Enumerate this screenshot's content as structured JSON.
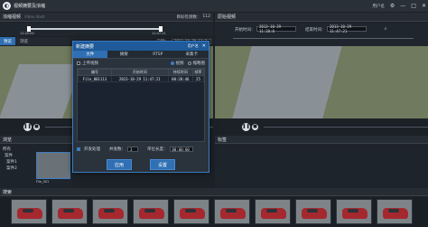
{
  "app": {
    "title": "视频摘要及浓缩",
    "user": "用户名"
  },
  "left_panel": {
    "title": "浓缩视频",
    "subtitle": "Video Abstr",
    "frame_label": "目标检测数：",
    "frame_value": "112",
    "time_start": "11:20:00",
    "time_end": "11:47:21"
  },
  "right_panel": {
    "title": "原始视频",
    "start_label": "开始时间：",
    "start_value": "2013-10-29 11:20:0",
    "end_label": "结束时间：",
    "end_value": "2013-10-29 11:47:21"
  },
  "left_tabs": [
    "预览",
    "浏览"
  ],
  "left_date_label": "日期：",
  "left_date_value": "2013-10-29 11:2",
  "dialog": {
    "title": "新建摘要",
    "user": "用户名",
    "tabs": [
      "文件",
      "摘要",
      "RTSP",
      "采集卡"
    ],
    "upload_label": "上传视频",
    "option_video": "视频",
    "option_thumb": "缩略图",
    "table_headers": [
      "编号",
      "开始时间",
      "持续时间",
      "帧率"
    ],
    "rows": [
      {
        "id": "File_001113",
        "start": "2013-10-29 11:47:21",
        "duration": "00:20:46",
        "fps": "25"
      }
    ],
    "batch_label": "开发处理",
    "concurrency_label": "并发数：",
    "concurrency_value": "3",
    "unit_label": "单位长度：",
    "unit_value": "00:00:00",
    "apply_btn": "应用",
    "settings_btn": "设置"
  },
  "search_panel": {
    "title": "浏览",
    "items": [
      "所有",
      "案件",
      "案件1",
      "案件2"
    ],
    "thumb_caption": "File_001"
  },
  "tag_panel": {
    "title": "标签"
  },
  "filmstrip": {
    "title": "搜索"
  },
  "colors": {
    "accent": "#2f6fb3",
    "dialog_border": "#3c7cc2"
  }
}
